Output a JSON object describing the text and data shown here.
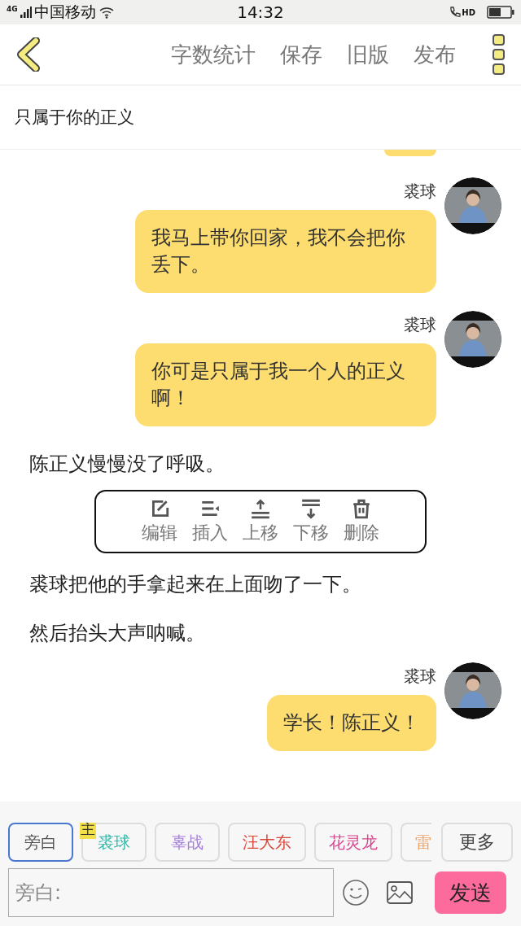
{
  "status_bar": {
    "network": "4G",
    "carrier": "中国移动",
    "time": "14:32",
    "call_badge": "HD"
  },
  "toolbar": {
    "actions": [
      "字数统计",
      "保存",
      "旧版",
      "发布"
    ]
  },
  "chapter_title": "只属于你的正义",
  "messages": [
    {
      "kind": "bubble-edge"
    },
    {
      "kind": "dialog",
      "speaker": "裘球",
      "text": "我马上带你回家，我不会把你丢下。"
    },
    {
      "kind": "dialog",
      "speaker": "裘球",
      "text": "你可是只属于我一个人的正义啊！"
    },
    {
      "kind": "narration",
      "text": "陈正义慢慢没了呼吸。"
    },
    {
      "kind": "menu",
      "actions": [
        {
          "kind": "edit",
          "label": "编辑"
        },
        {
          "kind": "insert",
          "label": "插入"
        },
        {
          "kind": "up",
          "label": "上移"
        },
        {
          "kind": "down",
          "label": "下移"
        },
        {
          "kind": "delete",
          "label": "删除"
        }
      ]
    },
    {
      "kind": "narration",
      "text": "裘球把他的手拿起来在上面吻了一下。"
    },
    {
      "kind": "narration",
      "text": "然后抬头大声呐喊。"
    },
    {
      "kind": "dialog",
      "speaker": "裘球",
      "text": "学长！陈正义！"
    }
  ],
  "roles": [
    {
      "name": "旁白",
      "selected": true,
      "color": "#555555"
    },
    {
      "name": "裘球",
      "selected": false,
      "color": "#36b8a8",
      "badge": "主"
    },
    {
      "name": "辜战",
      "selected": false,
      "color": "#a67fd8"
    },
    {
      "name": "汪大东",
      "selected": false,
      "color": "#d9483c"
    },
    {
      "name": "花灵龙",
      "selected": false,
      "color": "#d9468f"
    },
    {
      "name": "雷",
      "selected": false,
      "color": "#f0a060"
    }
  ],
  "more_button": "更多",
  "input": {
    "placeholder": "旁白:"
  },
  "send_button": "发送"
}
